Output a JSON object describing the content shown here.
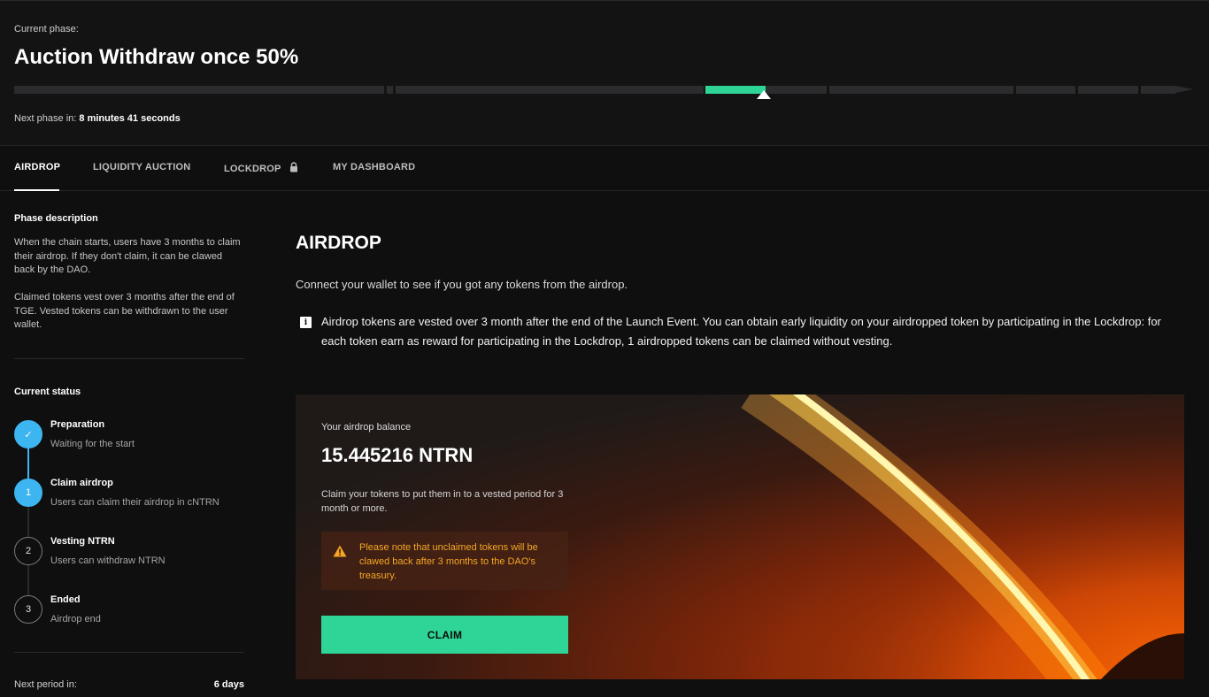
{
  "header": {
    "phase_label": "Current phase:",
    "phase_title": "Auction Withdraw once 50%",
    "next_phase_label": "Next phase in:",
    "next_phase_value": "8 minutes 41 seconds"
  },
  "tabs": [
    {
      "label": "AIRDROP",
      "active": true
    },
    {
      "label": "LIQUIDITY AUCTION",
      "active": false
    },
    {
      "label": "LOCKDROP",
      "active": false,
      "icon": "lock-icon"
    },
    {
      "label": "MY DASHBOARD",
      "active": false
    }
  ],
  "sidebar": {
    "description_title": "Phase description",
    "description_p1": "When the chain starts, users have 3 months to claim their airdrop. If they don't claim, it can be clawed back by the DAO.",
    "description_p2": "Claimed tokens vest over 3 months after the end of TGE. Vested tokens can be withdrawn to the user wallet.",
    "status_title": "Current status",
    "steps": [
      {
        "marker": "✓",
        "title": "Preparation",
        "subtitle": "Waiting for the start"
      },
      {
        "marker": "1",
        "title": "Claim airdrop",
        "subtitle": "Users can claim their airdrop in cNTRN"
      },
      {
        "marker": "2",
        "title": "Vesting NTRN",
        "subtitle": "Users can withdraw NTRN"
      },
      {
        "marker": "3",
        "title": "Ended",
        "subtitle": "Airdrop end"
      }
    ],
    "next_period_label": "Next period in:",
    "next_period_value": "6 days"
  },
  "main": {
    "title": "AIRDROP",
    "connect_text": "Connect your wallet to see if you got any tokens from the airdrop.",
    "info_icon": "i",
    "info_text": "Airdrop tokens are vested over 3 month after the end of the Launch Event. You can obtain early liquidity on your airdropped token by participating in the Lockdrop: for each token earn as reward for participating in the Lockdrop, 1 airdropped tokens can be claimed without vesting."
  },
  "card": {
    "balance_label": "Your airdrop balance",
    "balance_value": "15.445216 NTRN",
    "claim_description": "Claim your tokens to put them in to a vested period for 3 month or more.",
    "warning_text": "Please note that unclaimed tokens will be clawed back after 3 months to the DAO's treasury.",
    "claim_button": "CLAIM"
  },
  "colors": {
    "accent_green": "#2ed597",
    "step_blue": "#3db5f0",
    "warning_orange": "#f5a623"
  }
}
